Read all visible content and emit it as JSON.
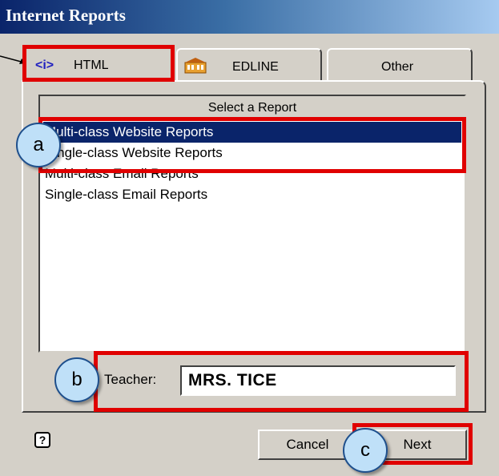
{
  "window": {
    "title": "Internet Reports"
  },
  "tabs": [
    {
      "icon": "html-code-icon",
      "label": "HTML",
      "icon_text": "<i>"
    },
    {
      "icon": "building-icon",
      "label": "EDLINE"
    },
    {
      "label": "Other"
    }
  ],
  "report_list": {
    "header": "Select a Report",
    "items": [
      "Multi-class Website Reports",
      "Single-class Website Reports",
      "Multi-class Email Reports",
      "Single-class Email Reports"
    ],
    "selected": "Multi-class Website Reports"
  },
  "teacher": {
    "label": "Teacher:",
    "value": "MRS. TICE"
  },
  "footer": {
    "help": "?",
    "cancel_label": "Cancel",
    "next_label": "Next"
  },
  "callouts": {
    "a": "a",
    "b": "b",
    "c": "c"
  },
  "colors": {
    "highlight": "#e00000",
    "callout_fill": "#bfe0f8",
    "selection": "#0a246a"
  }
}
